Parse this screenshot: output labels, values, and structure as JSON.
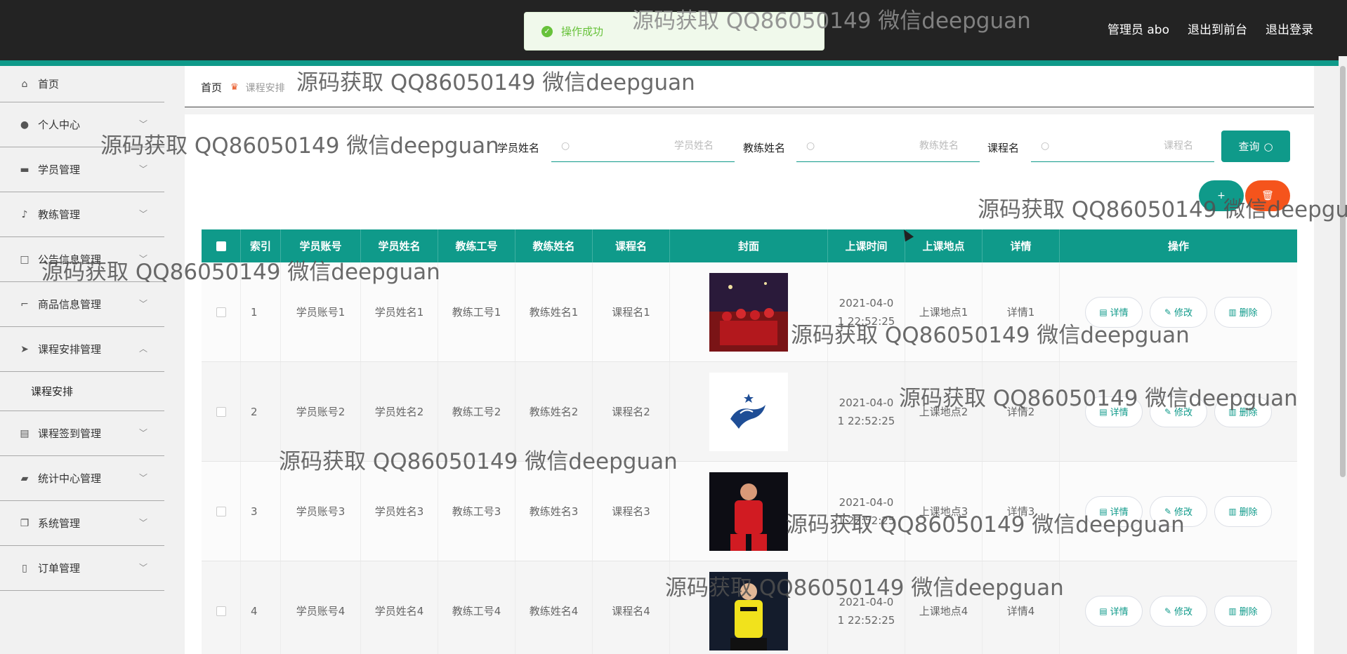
{
  "topbar": {
    "admin_label": "管理员 abo",
    "to_front": "退出到前台",
    "logout": "退出登录"
  },
  "toast": {
    "message": "操作成功"
  },
  "sidebar": {
    "items": [
      {
        "label": "首页",
        "icon": "home-icon"
      },
      {
        "label": "个人中心",
        "icon": "user-icon"
      },
      {
        "label": "学员管理",
        "icon": "briefcase-icon"
      },
      {
        "label": "教练管理",
        "icon": "microphone-icon"
      },
      {
        "label": "公告信息管理",
        "icon": "chat-icon"
      },
      {
        "label": "商品信息管理",
        "icon": "crop-icon"
      },
      {
        "label": "课程安排管理",
        "icon": "send-icon"
      },
      {
        "label": "课程签到管理",
        "icon": "clipboard-icon"
      },
      {
        "label": "统计中心管理",
        "icon": "camera-icon"
      },
      {
        "label": "系统管理",
        "icon": "copy-icon"
      },
      {
        "label": "订单管理",
        "icon": "phone-icon"
      }
    ],
    "submenu": "课程安排"
  },
  "breadcrumb": {
    "home": "首页",
    "current": "课程安排"
  },
  "search": {
    "student_label": "学员姓名",
    "student_placeholder": "学员姓名",
    "coach_label": "教练姓名",
    "coach_placeholder": "教练姓名",
    "course_label": "课程名",
    "course_placeholder": "课程名",
    "query_label": "查询"
  },
  "actions": {
    "add_label": "+",
    "delete_icon": "trash-icon"
  },
  "table": {
    "headers": [
      "索引",
      "学员账号",
      "学员姓名",
      "教练工号",
      "教练姓名",
      "课程名",
      "封面",
      "上课时间",
      "上课地点",
      "详情",
      "操作"
    ],
    "ops": {
      "detail": "详情",
      "edit": "修改",
      "delete": "删除"
    },
    "rows": [
      {
        "index": "1",
        "account": "学员账号1",
        "student": "学员姓名1",
        "coach_no": "教练工号1",
        "coach": "教练姓名1",
        "course": "课程名1",
        "time": "2021-04-01 22:52:25",
        "place": "上课地点1",
        "detail": "详情1"
      },
      {
        "index": "2",
        "account": "学员账号2",
        "student": "学员姓名2",
        "coach_no": "教练工号2",
        "coach": "教练姓名2",
        "course": "课程名2",
        "time": "2021-04-01 22:52:25",
        "place": "上课地点2",
        "detail": "详情2"
      },
      {
        "index": "3",
        "account": "学员账号3",
        "student": "学员姓名3",
        "coach_no": "教练工号3",
        "coach": "教练姓名3",
        "course": "课程名3",
        "time": "2021-04-01 22:52:25",
        "place": "上课地点3",
        "detail": "详情3"
      },
      {
        "index": "4",
        "account": "学员账号4",
        "student": "学员姓名4",
        "coach_no": "教练工号4",
        "coach": "教练姓名4",
        "course": "课程名4",
        "time": "2021-04-01 22:52:25",
        "place": "上课地点4",
        "detail": "详情4"
      }
    ]
  },
  "watermark": "源码获取 QQ86050149 微信deepguan",
  "colors": {
    "accent": "#0f9a8a",
    "danger": "#f5541c",
    "topbar": "#232323",
    "success": "#67c23a"
  }
}
